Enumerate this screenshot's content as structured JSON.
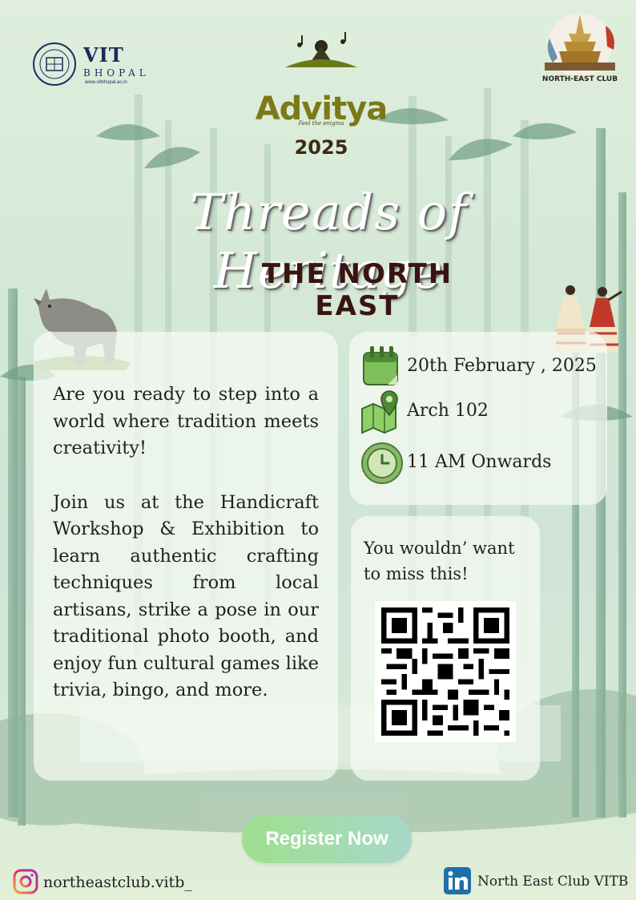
{
  "header": {
    "institute_name": "VIT",
    "institute_location": "BHOPAL",
    "institute_url": "www.vitbhopal.ac.in",
    "fest_name": "Advitya",
    "fest_tagline": "Feel the enigma",
    "fest_year": "2025",
    "club_name": "NORTH-EAST CLUB"
  },
  "event": {
    "title": "Threads of Heritage",
    "subtitle": "THE NORTH EAST"
  },
  "description": {
    "paragraph_1": "Are you ready to step into a world where tradition meets creativity!",
    "paragraph_2": "Join us at the Handicraft Workshop & Exhibition to learn authentic crafting techniques from local artisans, strike a pose in our traditional photo booth, and enjoy fun cultural games like trivia, bingo, and more."
  },
  "details": {
    "date": "20th February , 2025",
    "venue": "Arch 102",
    "time": "11 AM Onwards"
  },
  "qr_section": {
    "message": "You wouldn’ want to miss this!"
  },
  "cta": {
    "register_label": "Register Now"
  },
  "footer": {
    "instagram_handle": "northeastclub.vitb_",
    "linkedin_name": "North East Club VITB"
  },
  "icons": {
    "date": "calendar-icon",
    "venue": "map-pin-icon",
    "time": "clock-icon",
    "instagram": "instagram-icon",
    "linkedin": "linkedin-icon"
  },
  "colors": {
    "subtitle": "#3a1410",
    "fest_name": "#7c7a18",
    "button_start": "#9fdf8f",
    "button_end": "#a8d8c8",
    "linkedin": "#1f6fa8",
    "instagram": "#d6336c"
  }
}
